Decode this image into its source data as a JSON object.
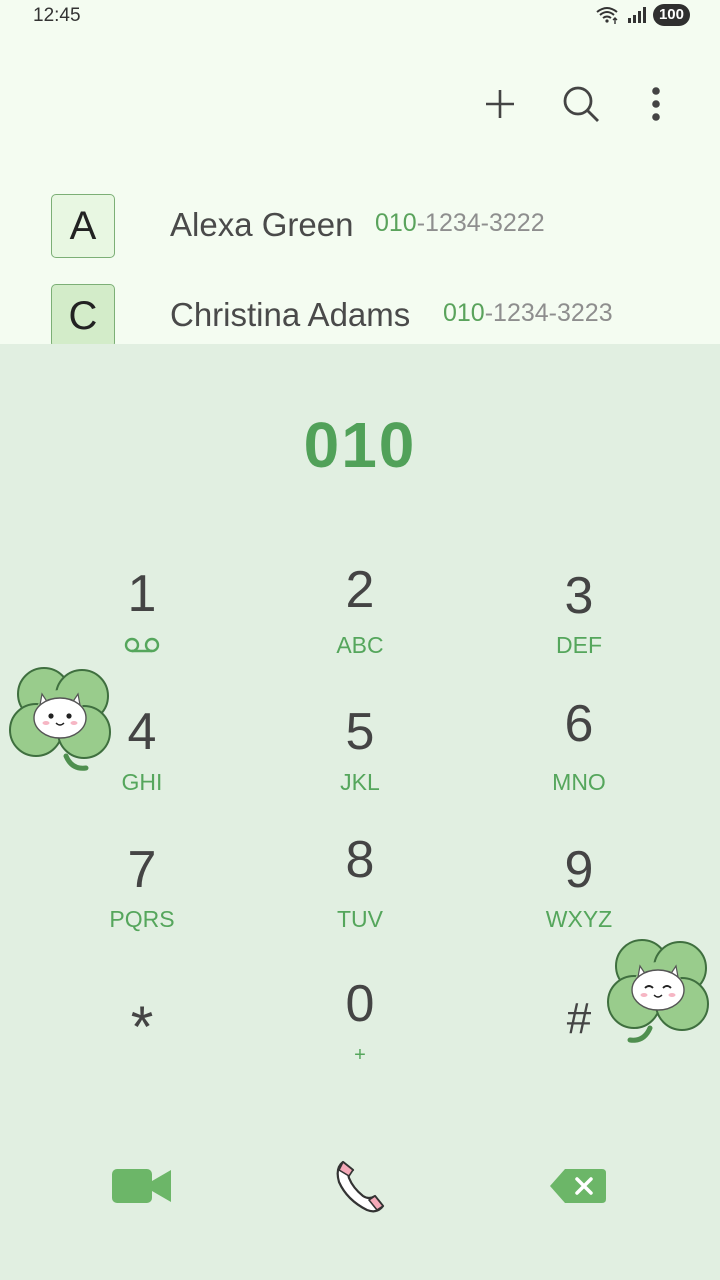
{
  "status_bar": {
    "time": "12:45",
    "battery": "100"
  },
  "toolbar": {
    "add_icon": "plus-icon",
    "search_icon": "search-icon",
    "more_icon": "more-vert-icon"
  },
  "contacts": [
    {
      "initial": "A",
      "name": "Alexa Green",
      "number_match": "010",
      "number_rest": "-1234-3222"
    },
    {
      "initial": "C",
      "name": "Christina Adams",
      "number_match": "010",
      "number_rest": "-1234-3223"
    }
  ],
  "dialer": {
    "input": "010",
    "keys": [
      {
        "digit": "1",
        "letters": ""
      },
      {
        "digit": "2",
        "letters": "ABC"
      },
      {
        "digit": "3",
        "letters": "DEF"
      },
      {
        "digit": "4",
        "letters": "GHI"
      },
      {
        "digit": "5",
        "letters": "JKL"
      },
      {
        "digit": "6",
        "letters": "MNO"
      },
      {
        "digit": "7",
        "letters": "PQRS"
      },
      {
        "digit": "8",
        "letters": "TUV"
      },
      {
        "digit": "9",
        "letters": "WXYZ"
      },
      {
        "digit": "*",
        "letters": ""
      },
      {
        "digit": "0",
        "letters": "+"
      },
      {
        "digit": "#",
        "letters": ""
      }
    ]
  },
  "bottom_bar": {
    "video_icon": "video-call-icon",
    "call_icon": "phone-call-icon",
    "delete_icon": "backspace-icon"
  },
  "colors": {
    "accent": "#51a159",
    "panel": "#e1efe1",
    "background": "#f4fcf1"
  }
}
